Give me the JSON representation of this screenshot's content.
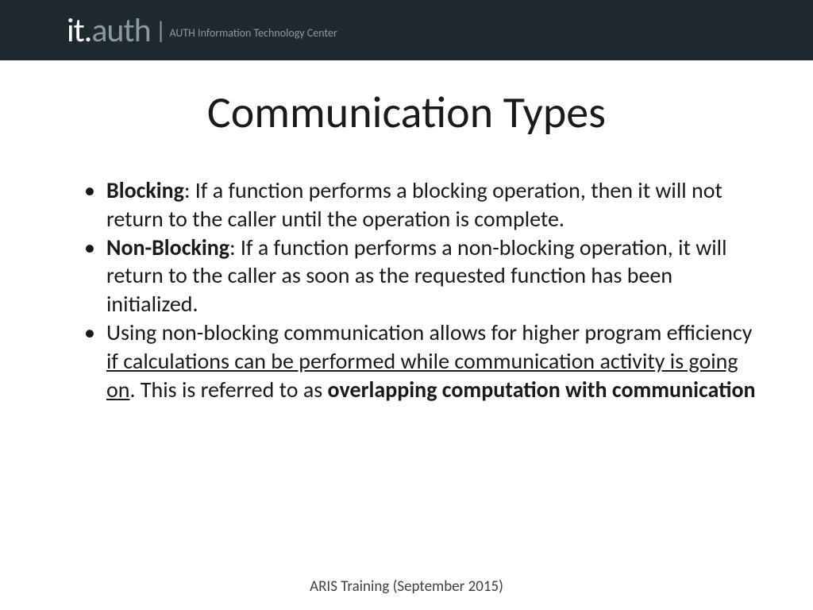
{
  "header": {
    "logo_it": "it.",
    "logo_auth": "auth",
    "pipe": "|",
    "desc": "AUTH Information Technology Center"
  },
  "title": "Communication Types",
  "bullets": {
    "b1_term": "Blocking",
    "b1_rest": ": If a function performs a blocking operation, then it will not return to the caller until the operation is complete.",
    "b2_term": "Non-Blocking",
    "b2_rest": ": If a function performs a non-blocking operation, it will return to the caller as soon as the requested function has been initialized.",
    "b3_a": "Using non-blocking communication allows for higher program efficiency ",
    "b3_u": "if calculations can be performed while communication activity is going on",
    "b3_b": ". This is referred to as ",
    "b3_bold": "overlapping computation with communication"
  },
  "footer": "ARIS Training (September 2015)"
}
